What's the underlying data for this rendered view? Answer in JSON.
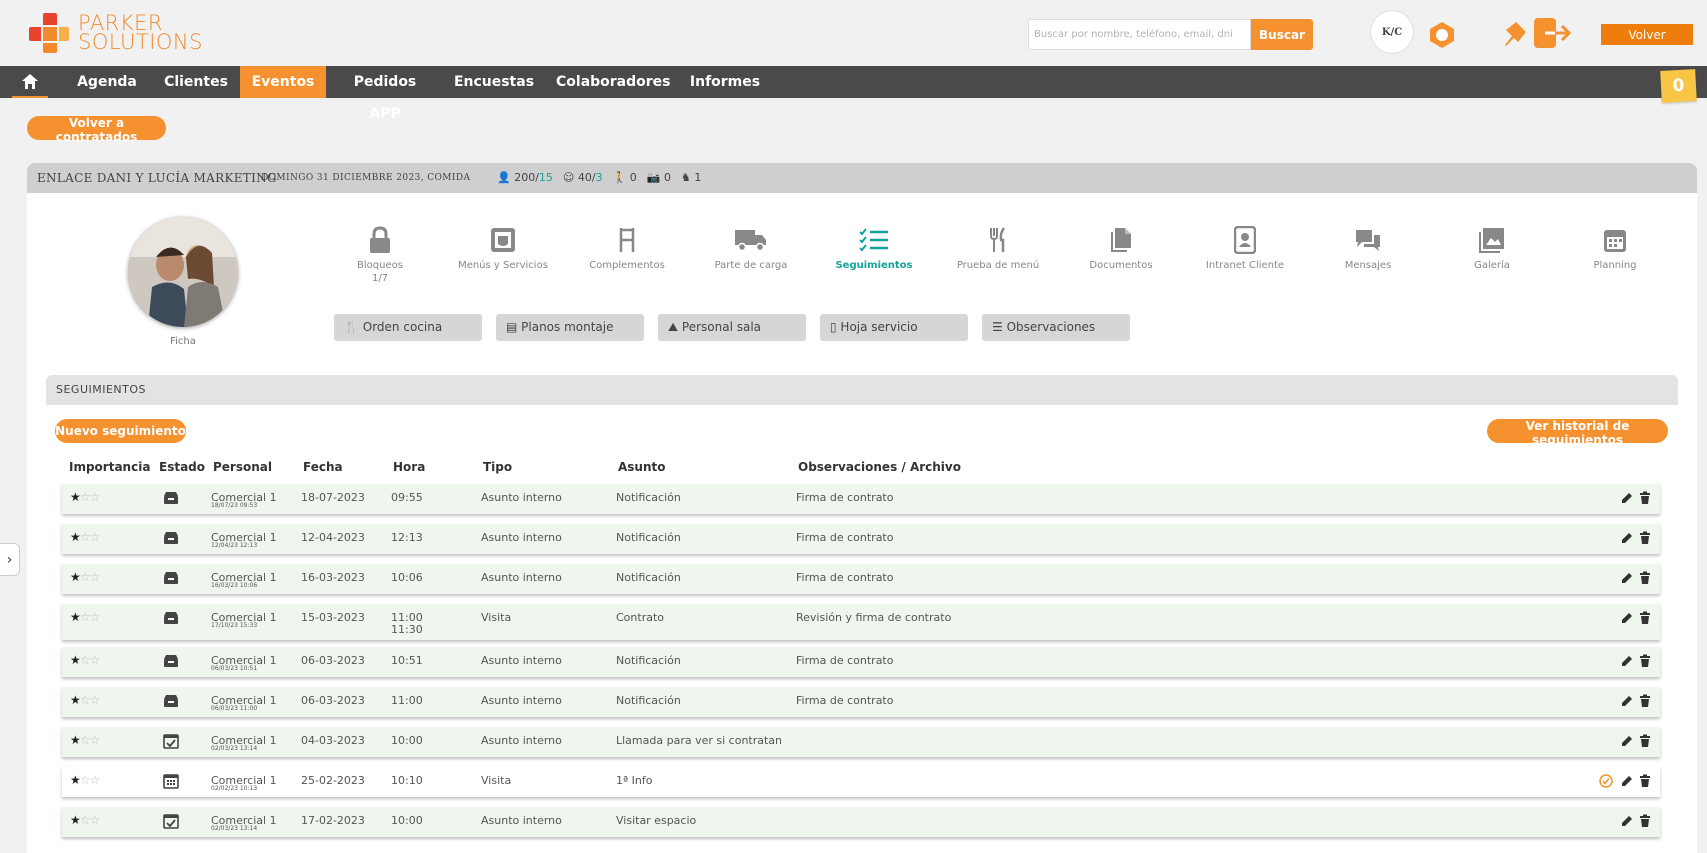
{
  "brand": {
    "line1": "PARKER",
    "line2": "SOLUTIONS"
  },
  "search": {
    "placeholder": "Buscar por nombre, teléfono, email, dni",
    "button": "Buscar"
  },
  "user": {
    "initials": "K/C"
  },
  "header": {
    "volver": "Volver"
  },
  "nav": {
    "items": [
      "Agenda",
      "Clientes",
      "Eventos",
      "Pedidos APP",
      "Encuestas",
      "Colaboradores",
      "Informes"
    ],
    "active": "Eventos"
  },
  "cart": {
    "count": "0"
  },
  "back_button": "Volver a contratados",
  "event": {
    "title": "ENLACE DANI Y LUCÍA MARKETING",
    "date": "DOMINGO 31 DICIEMBRE 2023, COMIDA",
    "stats": {
      "guests": "200/",
      "guests_confirmed": "15",
      "kids": "40/",
      "kids_confirmed": "3",
      "staff": "0",
      "photos": "0",
      "other": "1"
    }
  },
  "profile": {
    "label": "Ficha"
  },
  "tools": [
    {
      "label": "Bloqueos",
      "sub": "1/7",
      "icon": "lock-icon"
    },
    {
      "label": "Menús y Servicios",
      "icon": "menu-card-icon"
    },
    {
      "label": "Complementos",
      "icon": "chair-icon"
    },
    {
      "label": "Parte de carga",
      "icon": "truck-icon"
    },
    {
      "label": "Seguimientos",
      "icon": "checklist-icon"
    },
    {
      "label": "Prueba de menú",
      "icon": "cutlery-icon"
    },
    {
      "label": "Documentos",
      "icon": "documents-icon"
    },
    {
      "label": "Intranet Cliente",
      "icon": "id-badge-icon"
    },
    {
      "label": "Mensajes",
      "icon": "chat-icon"
    },
    {
      "label": "Galería",
      "icon": "gallery-icon"
    },
    {
      "label": "Planning",
      "icon": "calendar-icon"
    }
  ],
  "subbuttons": [
    "Orden cocina",
    "Planos montaje",
    "Personal sala",
    "Hoja servicio",
    "Observaciones"
  ],
  "section": {
    "title": "SEGUIMIENTOS",
    "new_button": "Nuevo seguimiento",
    "history_button": "Ver historial de seguimientos"
  },
  "columns": [
    "Importancia",
    "Estado",
    "Personal",
    "Fecha",
    "Hora",
    "Tipo",
    "Asunto",
    "Observaciones / Archivo"
  ],
  "rows": [
    {
      "stars": 1,
      "estado": "archive",
      "personal": "Comercial 1",
      "sub": "18/07/23 09:53",
      "fecha": "18-07-2023",
      "hora": "09:55",
      "hora2": "",
      "tipo": "Asunto interno",
      "asunto": "Notificación",
      "obs": "Firma de contrato",
      "check": false,
      "white": false
    },
    {
      "stars": 1,
      "estado": "archive",
      "personal": "Comercial 1",
      "sub": "12/04/23 12:13",
      "fecha": "12-04-2023",
      "hora": "12:13",
      "hora2": "",
      "tipo": "Asunto interno",
      "asunto": "Notificación",
      "obs": "Firma de contrato",
      "check": false,
      "white": false
    },
    {
      "stars": 1,
      "estado": "archive",
      "personal": "Comercial 1",
      "sub": "16/03/23 10:06",
      "fecha": "16-03-2023",
      "hora": "10:06",
      "hora2": "",
      "tipo": "Asunto interno",
      "asunto": "Notificación",
      "obs": "Firma de contrato",
      "check": false,
      "white": false
    },
    {
      "stars": 1,
      "estado": "archive",
      "personal": "Comercial 1",
      "sub": "17/10/23 15:33",
      "fecha": "15-03-2023",
      "hora": "11:00",
      "hora2": "11:30",
      "tipo": "Visita",
      "asunto": "Contrato",
      "obs": "Revisión y firma de contrato",
      "check": false,
      "white": false
    },
    {
      "stars": 1,
      "estado": "archive",
      "personal": "Comercial 1",
      "sub": "06/03/23 10:51",
      "fecha": "06-03-2023",
      "hora": "10:51",
      "hora2": "",
      "tipo": "Asunto interno",
      "asunto": "Notificación",
      "obs": "Firma de contrato",
      "check": false,
      "white": false
    },
    {
      "stars": 1,
      "estado": "archive",
      "personal": "Comercial 1",
      "sub": "06/03/23 11:00",
      "fecha": "06-03-2023",
      "hora": "11:00",
      "hora2": "",
      "tipo": "Asunto interno",
      "asunto": "Notificación",
      "obs": "Firma de contrato",
      "check": false,
      "white": false
    },
    {
      "stars": 1,
      "estado": "calendar-check",
      "personal": "Comercial 1",
      "sub": "02/03/23 13:14",
      "fecha": "04-03-2023",
      "hora": "10:00",
      "hora2": "",
      "tipo": "Asunto interno",
      "asunto": "Llamada para ver si contratan",
      "obs": "",
      "check": false,
      "white": false
    },
    {
      "stars": 1,
      "estado": "calendar",
      "personal": "Comercial 1",
      "sub": "02/02/23 10:13",
      "fecha": "25-02-2023",
      "hora": "10:10",
      "hora2": "",
      "tipo": "Visita",
      "asunto": "1ª Info",
      "obs": "",
      "check": true,
      "white": true
    },
    {
      "stars": 1,
      "estado": "calendar-check",
      "personal": "Comercial 1",
      "sub": "02/03/23 13:14",
      "fecha": "17-02-2023",
      "hora": "10:00",
      "hora2": "",
      "tipo": "Asunto interno",
      "asunto": "Visitar espacio",
      "obs": "",
      "check": false,
      "white": false
    }
  ],
  "colors": {
    "accent": "#f5922f",
    "teal": "#14a39a",
    "nav": "#4a4a4a",
    "row": "#eef6ee"
  }
}
